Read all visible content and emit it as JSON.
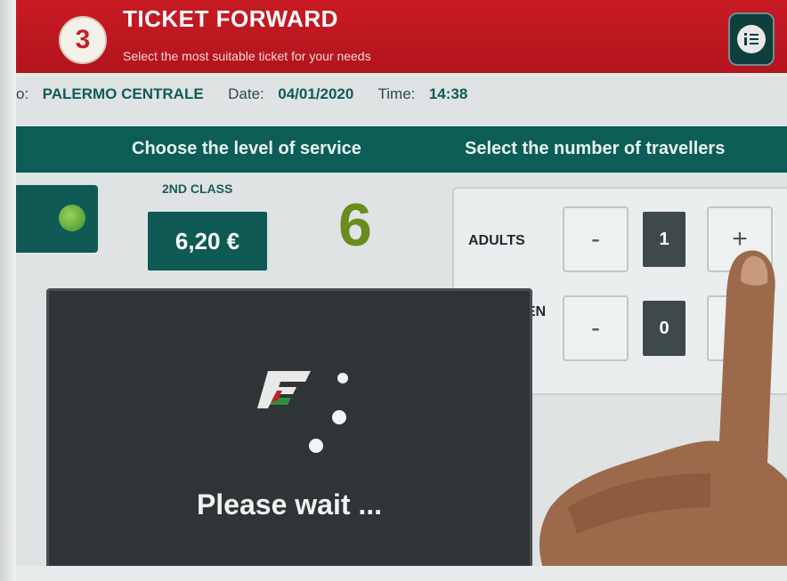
{
  "header": {
    "step_number": "3",
    "title": "TICKET FORWARD",
    "subtitle": "Select the most suitable ticket for your needs",
    "info_icon": "info-list-icon"
  },
  "trip": {
    "to_prefix": "o:",
    "destination": "PALERMO CENTRALE",
    "date_label": "Date:",
    "date": "04/01/2020",
    "time_label": "Time:",
    "time": "14:38"
  },
  "sections": {
    "service_title": "Choose the level of service",
    "travellers_title": "Select the number of travellers"
  },
  "service": {
    "class_label": "2ND CLASS",
    "price": "6,20 €"
  },
  "overlay_number": "6",
  "travellers": {
    "adults_label": "ADULTS",
    "adults_count": "1",
    "children_label": "CHILDR EN",
    "children_count": "0",
    "minus": "-",
    "plus": "+"
  },
  "modal": {
    "message": "Please wait ..."
  },
  "colors": {
    "header_red": "#c81b24",
    "teal": "#0d5d57",
    "overlay_green": "#6b8b1f",
    "modal_bg": "#2f3436"
  }
}
